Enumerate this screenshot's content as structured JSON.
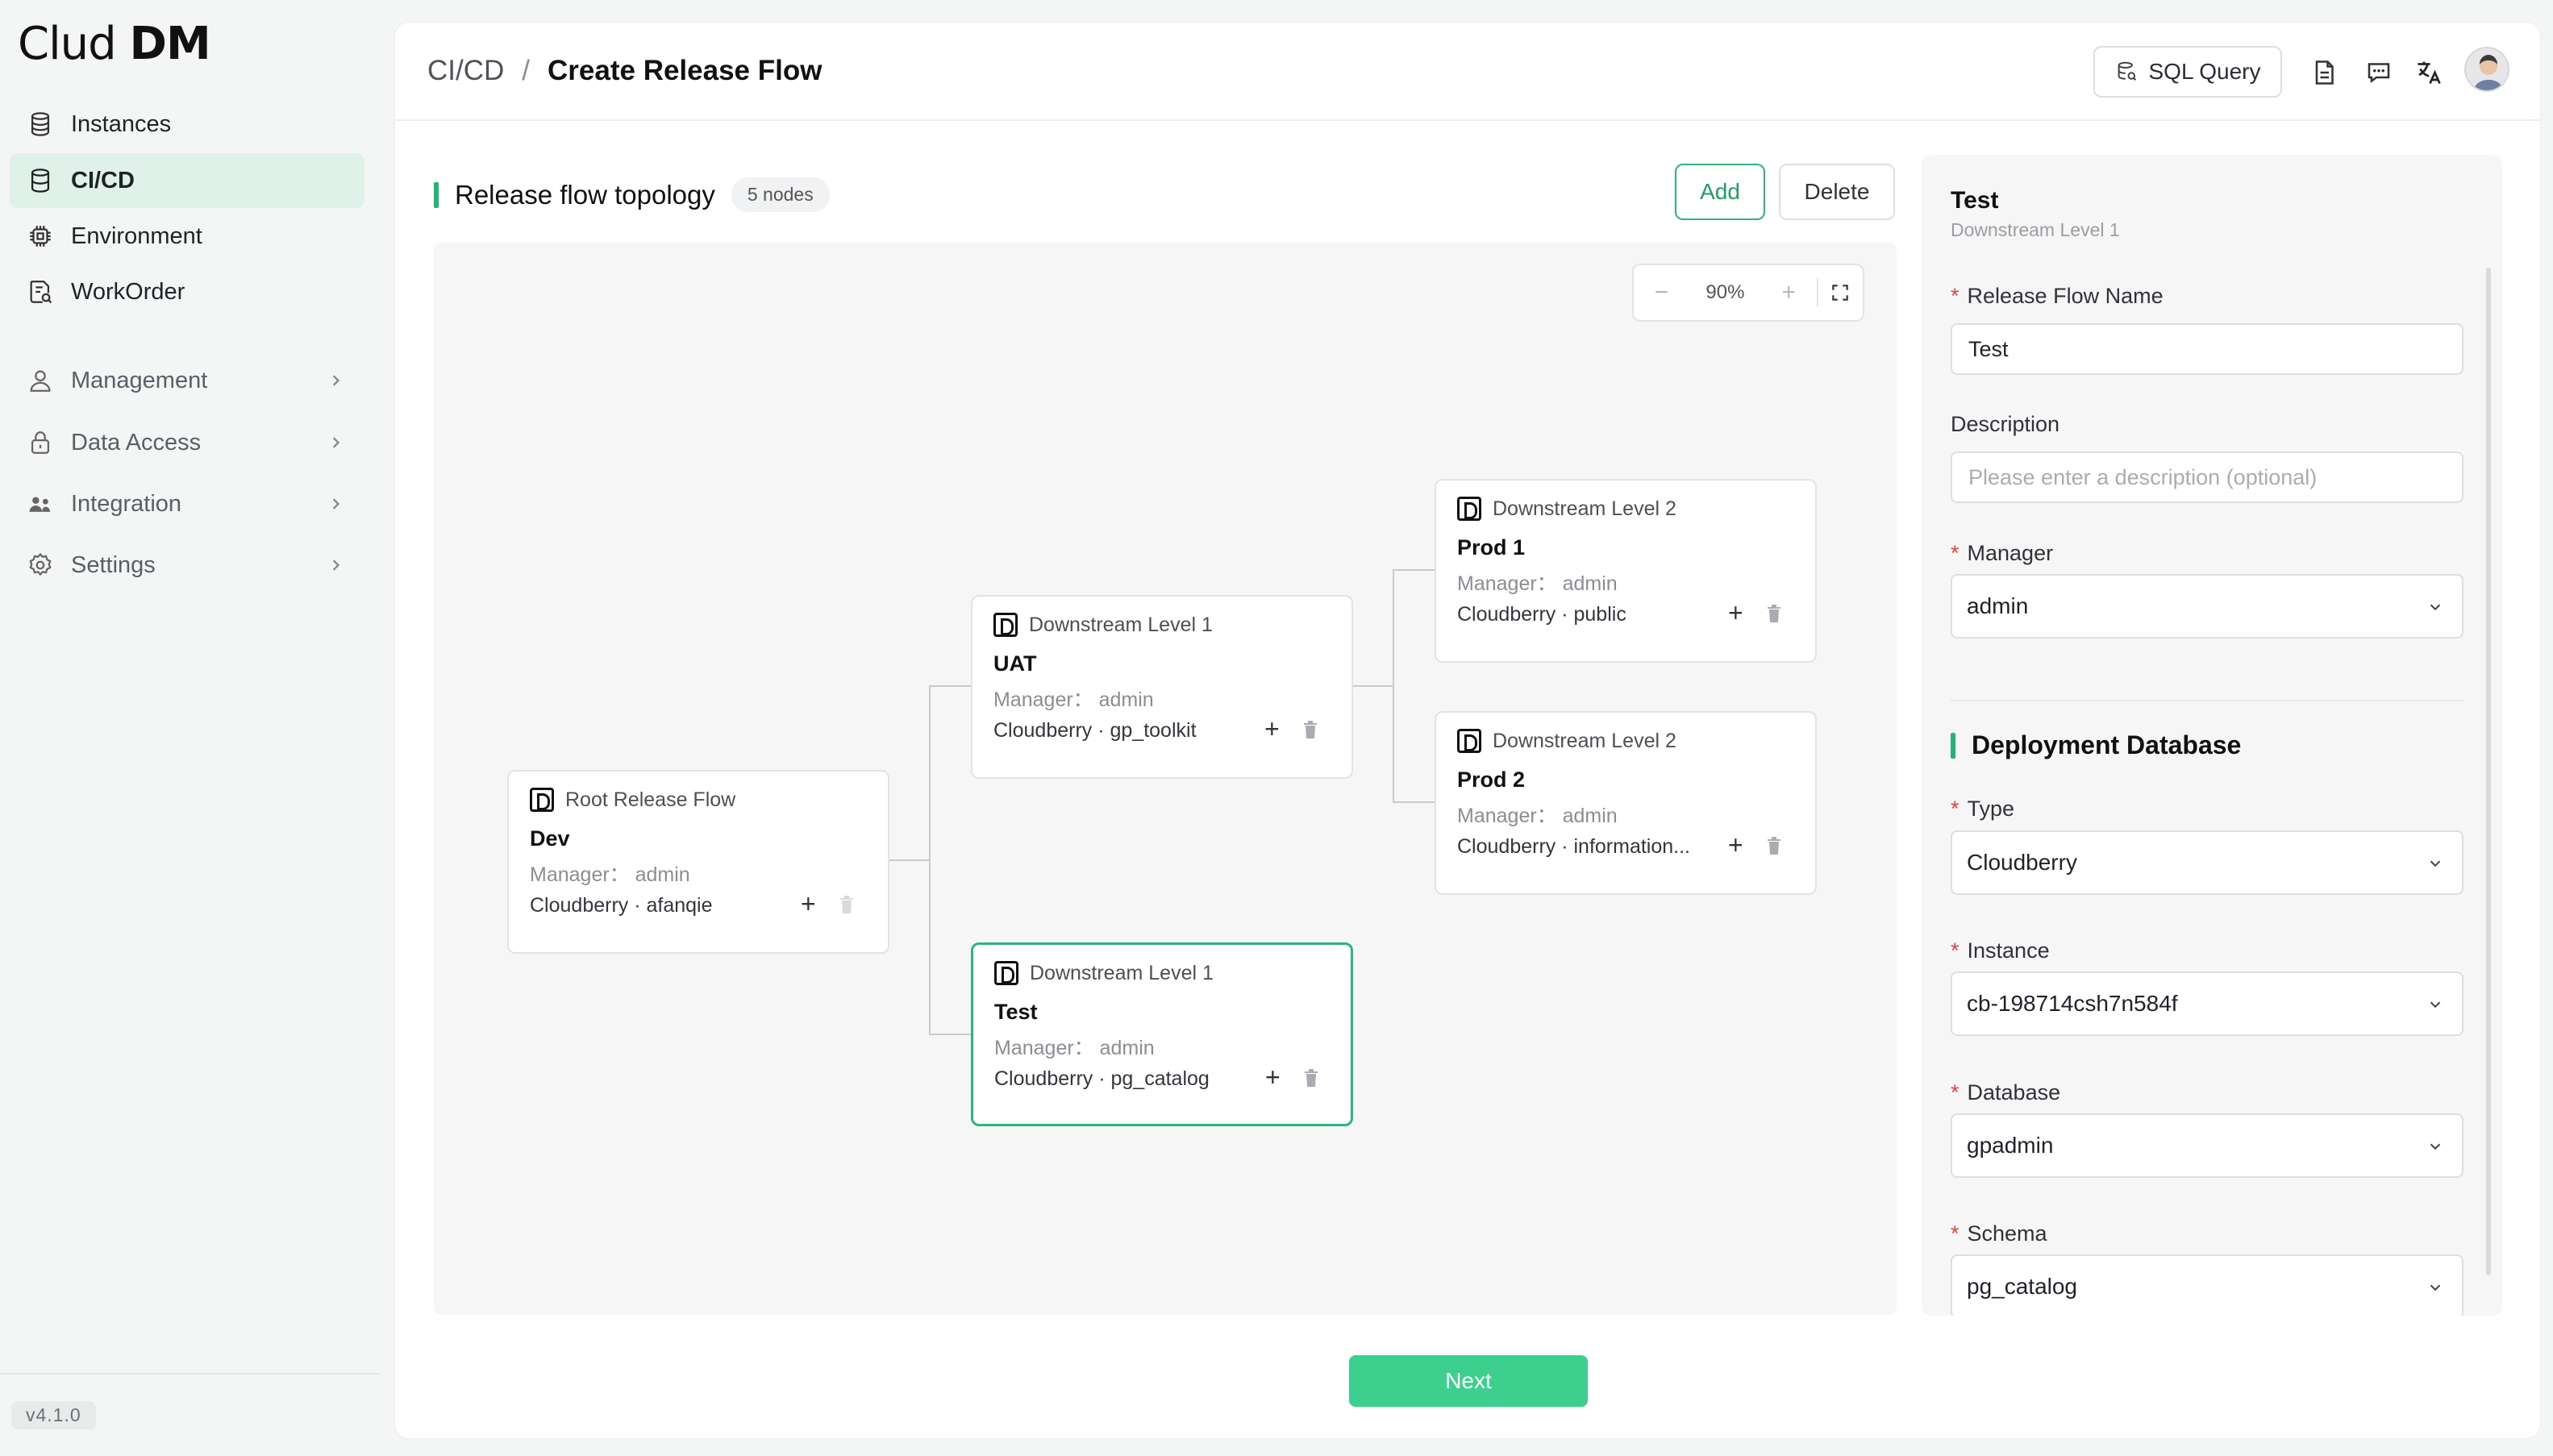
{
  "brand": {
    "logo_light": "Cl",
    "logo_mid": "ud ",
    "logo_bold": "DM"
  },
  "sidebar": {
    "items": [
      {
        "label": "Instances",
        "icon": "database-icon"
      },
      {
        "label": "CI/CD",
        "icon": "database-stack-icon",
        "active": true
      },
      {
        "label": "Environment",
        "icon": "chip-icon"
      },
      {
        "label": "WorkOrder",
        "icon": "document-search-icon"
      }
    ],
    "groups": [
      {
        "label": "Management",
        "icon": "user-icon"
      },
      {
        "label": "Data Access",
        "icon": "lock-icon"
      },
      {
        "label": "Integration",
        "icon": "users-icon"
      },
      {
        "label": "Settings",
        "icon": "gear-icon"
      }
    ],
    "version": "v4.1.0"
  },
  "header": {
    "breadcrumb_parent": "CI/CD",
    "breadcrumb_sep": "/",
    "title": "Create Release Flow",
    "sql_button": "SQL Query"
  },
  "topology": {
    "title": "Release flow topology",
    "count": "5 nodes",
    "add_label": "Add",
    "delete_label": "Delete",
    "zoom": "90%",
    "nodes": [
      {
        "level": "Root Release Flow",
        "name": "Dev",
        "manager": "Manager： admin",
        "db": "Cloudberry · afanqie"
      },
      {
        "level": "Downstream Level 1",
        "name": "UAT",
        "manager": "Manager： admin",
        "db": "Cloudberry · gp_toolkit"
      },
      {
        "level": "Downstream Level 1",
        "name": "Test",
        "manager": "Manager： admin",
        "db": "Cloudberry · pg_catalog",
        "selected": true
      },
      {
        "level": "Downstream Level 2",
        "name": "Prod 1",
        "manager": "Manager： admin",
        "db": "Cloudberry · public"
      },
      {
        "level": "Downstream Level 2",
        "name": "Prod 2",
        "manager": "Manager： admin",
        "db": "Cloudberry · information..."
      }
    ]
  },
  "panel": {
    "title": "Test",
    "subtitle": "Downstream Level 1",
    "name_label": "Release Flow Name",
    "name_value": "Test",
    "desc_label": "Description",
    "desc_placeholder": "Please enter a description (optional)",
    "manager_label": "Manager",
    "manager_value": "admin",
    "deploy_title": "Deployment Database",
    "type_label": "Type",
    "type_value": "Cloudberry",
    "instance_label": "Instance",
    "instance_value": "cb-198714csh7n584f",
    "database_label": "Database",
    "database_value": "gpadmin",
    "schema_label": "Schema",
    "schema_value": "pg_catalog",
    "required_mark": "*"
  },
  "footer": {
    "next_label": "Next"
  },
  "colors": {
    "accent": "#2fb57c",
    "active_bg": "#dff1e8",
    "next_bg": "#3ccf8e",
    "required": "#e2453c"
  }
}
